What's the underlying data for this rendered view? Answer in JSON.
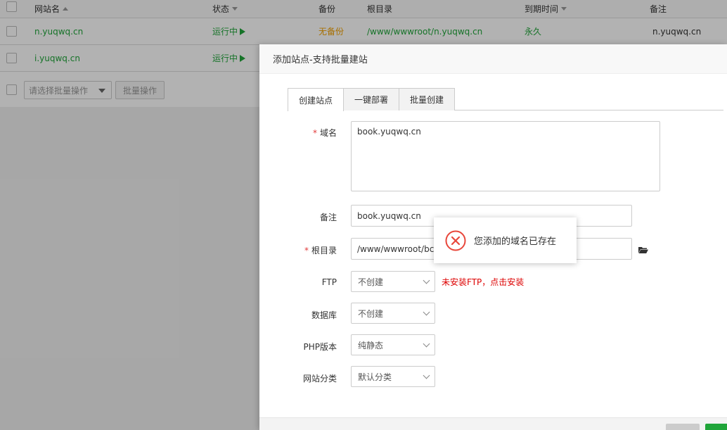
{
  "table": {
    "headers": {
      "site_name": "网站名",
      "status": "状态",
      "backup": "备份",
      "root": "根目录",
      "expire": "到期时间",
      "remark": "备注"
    },
    "rows": [
      {
        "site": "n.yuqwq.cn",
        "status": "运行中",
        "backup": "无备份",
        "root": "/www/wwwroot/n.yuqwq.cn",
        "expire": "永久",
        "remark": "n.yuqwq.cn"
      },
      {
        "site": "i.yuqwq.cn",
        "status": "运行中"
      }
    ],
    "batch_placeholder": "请选择批量操作",
    "batch_button": "批量操作"
  },
  "modal": {
    "title": "添加站点-支持批量建站",
    "tabs": [
      {
        "label": "创建站点",
        "active": true
      },
      {
        "label": "一键部署",
        "active": false
      },
      {
        "label": "批量创建",
        "active": false
      }
    ],
    "form": {
      "domain_label": "域名",
      "domain_value": "book.yuqwq.cn",
      "remark_label": "备注",
      "remark_value": "book.yuqwq.cn",
      "root_label": "根目录",
      "root_value": "/www/wwwroot/bc",
      "ftp_label": "FTP",
      "ftp_value": "不创建",
      "ftp_warning": "未安装FTP，点击安装",
      "db_label": "数据库",
      "db_value": "不创建",
      "php_label": "PHP版本",
      "php_value": "纯静态",
      "category_label": "网站分类",
      "category_value": "默认分类"
    }
  },
  "toast": {
    "message": "您添加的域名已存在"
  },
  "colors": {
    "brand_green": "#20a53a",
    "warning_red": "#dd0000",
    "error_icon": "#e8473b",
    "backup_orange": "#f0a000"
  }
}
